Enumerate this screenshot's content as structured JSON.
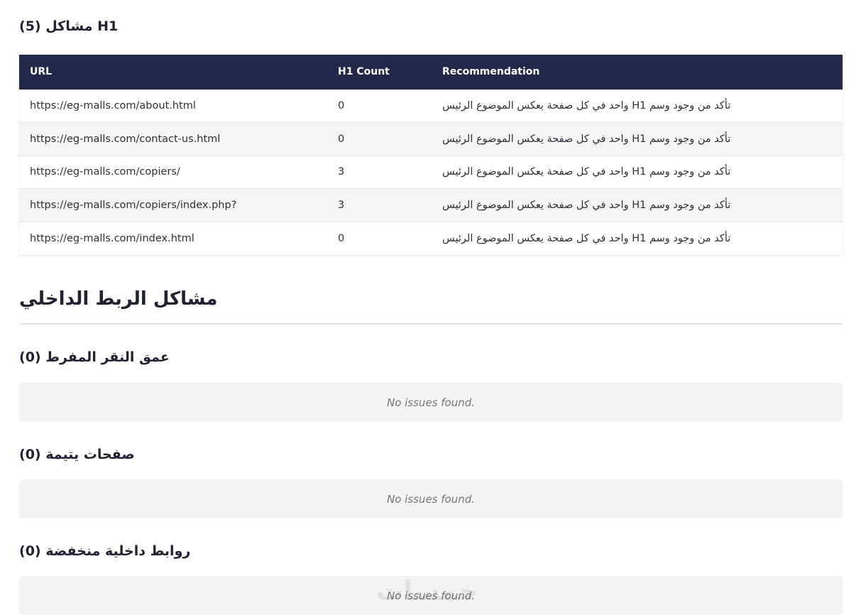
{
  "h1_section": {
    "title": "مشاكل (5) H1",
    "columns": [
      "URL",
      "H1 Count",
      "Recommendation"
    ],
    "rows": [
      {
        "url": "https://eg-malls.com/about.html",
        "count": "0",
        "recommendation": "تأكد من وجود وسم H1 واحد في كل صفحة يعكس الموضوع الرئيس"
      },
      {
        "url": "https://eg-malls.com/contact-us.html",
        "count": "0",
        "recommendation": "تأكد من وجود وسم H1 واحد في كل صفحة يعكس الموضوع الرئيس"
      },
      {
        "url": "https://eg-malls.com/copiers/",
        "count": "3",
        "recommendation": "تأكد من وجود وسم H1 واحد في كل صفحة يعكس الموضوع الرئيس"
      },
      {
        "url": "https://eg-malls.com/copiers/index.php?",
        "count": "3",
        "recommendation": "تأكد من وجود وسم H1 واحد في كل صفحة يعكس الموضوع الرئيس"
      },
      {
        "url": "https://eg-malls.com/index.html",
        "count": "0",
        "recommendation": "تأكد من وجود وسم H1 واحد في كل صفحة يعكس الموضوع الرئيس"
      }
    ]
  },
  "internal_linking": {
    "title": "مشاكل الربط الداخلي",
    "subsections": [
      {
        "title": "عمق النقر المفرط (0)",
        "empty_text": "No issues found."
      },
      {
        "title": "صفحات يتيمة (0)",
        "empty_text": "No issues found."
      },
      {
        "title": "روابط داخلية منخفضة (0)",
        "empty_text": "No issues found."
      }
    ]
  },
  "watermark": "خمسات"
}
